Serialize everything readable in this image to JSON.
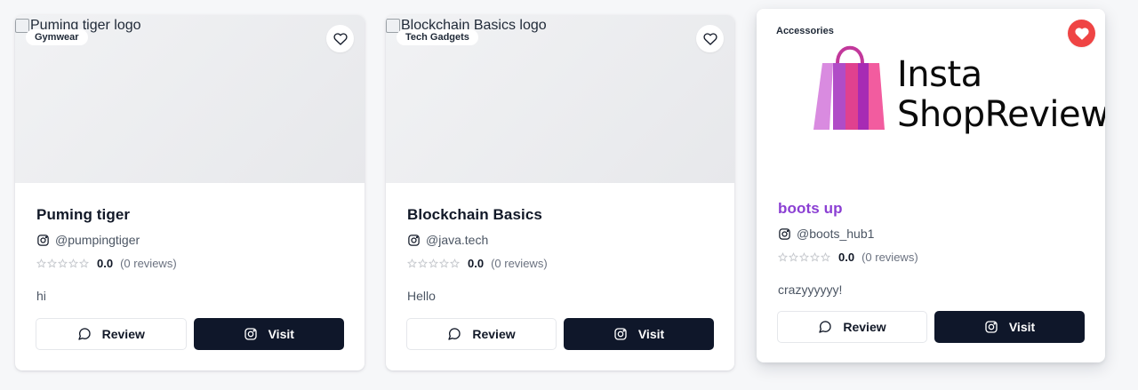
{
  "cards": [
    {
      "image_alt": "Puming tiger logo",
      "category": "Gymwear",
      "favorited": false,
      "title": "Puming tiger",
      "handle": "@pumpingtiger",
      "rating": 0,
      "score": "0.0",
      "reviews": "(0 reviews)",
      "description": "hi",
      "review_label": "Review",
      "visit_label": "Visit"
    },
    {
      "image_alt": "Blockchain Basics logo",
      "category": "Tech Gadgets",
      "favorited": false,
      "title": "Blockchain Basics",
      "handle": "@java.tech",
      "rating": 0,
      "score": "0.0",
      "reviews": "(0 reviews)",
      "description": "Hello",
      "review_label": "Review",
      "visit_label": "Visit"
    },
    {
      "brand_name": "Insta ShopReview",
      "brand_line_1": "Insta",
      "brand_line_2": "ShopReview",
      "category": "Accessories",
      "favorited": true,
      "title": "boots up",
      "handle": "@boots_hub1",
      "rating": 0,
      "score": "0.0",
      "reviews": "(0 reviews)",
      "description": "crazyyyyyy!",
      "review_label": "Review",
      "visit_label": "Visit"
    }
  ],
  "icons": {
    "favorite": "heart-icon",
    "handle": "instagram-icon",
    "review": "message-circle-icon",
    "visit": "instagram-icon",
    "star": "star-outline-icon"
  },
  "colors": {
    "background": "#f6f7f9",
    "primary_button": "#0f172a",
    "favorite_active": "#ef4444",
    "highlight_title": "#8b3fd3"
  }
}
